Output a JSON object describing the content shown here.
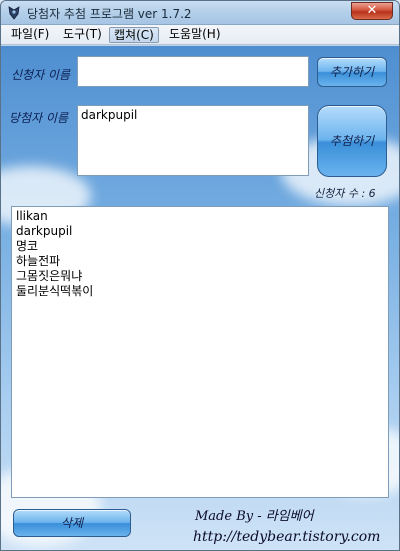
{
  "window": {
    "title": "당첨자 추첨 프로그램 ver 1.7.2",
    "close_glyph": "✕"
  },
  "menu": {
    "items": [
      {
        "label": "파일(F)"
      },
      {
        "label": "도구(T)"
      },
      {
        "label": "캡쳐(C)"
      },
      {
        "label": "도움말(H)"
      }
    ],
    "active_index": 2
  },
  "form": {
    "applicant_label": "신청자 이름",
    "applicant_value": "",
    "add_button": "추가하기",
    "winner_label": "당첨자 이름",
    "winner_value": "darkpupil",
    "draw_button": "추첨하기",
    "count_text": "신청자 수 : 6"
  },
  "list": {
    "items": [
      "llikan",
      "darkpupil",
      "명코",
      "하늘전파",
      "그몸짓은뭐냐",
      "둘리분식떡볶이"
    ]
  },
  "footer": {
    "delete_button": "삭제",
    "made_by": "Made By - 라임베어",
    "url": "http://tedybear.tistory.com"
  },
  "colors": {
    "label_text": "#0c1f52",
    "button_top": "#b5dcfb",
    "button_bottom": "#3a8fd8",
    "sky_top": "#4e8ed0"
  }
}
